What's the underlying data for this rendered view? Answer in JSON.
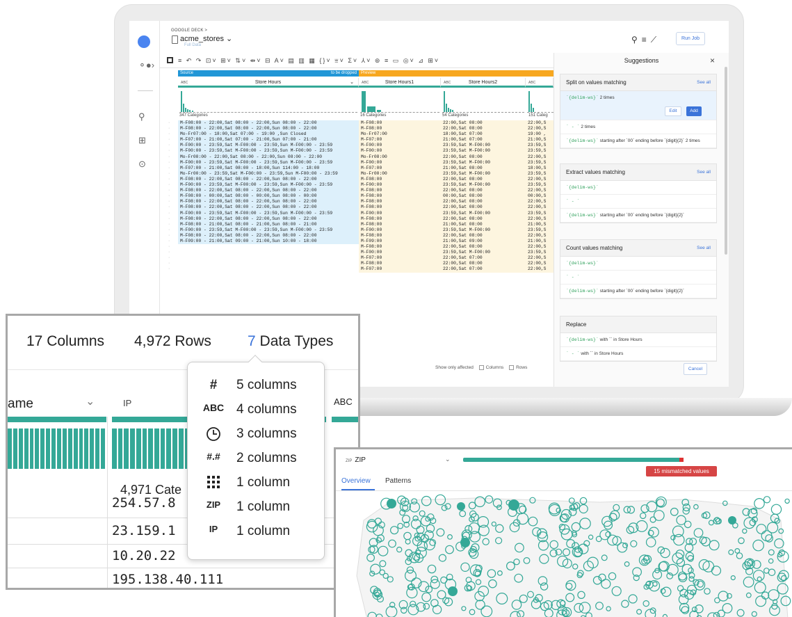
{
  "app": {
    "brand": "GOOGLE DECK >",
    "dataset": "acme_stores ⌄",
    "subtitle": "Full Data",
    "run_job": "Run Job"
  },
  "toolbar": {
    "icons": "≡  ↶ ↷  ⊡˅ ⊞˅ ⇅˅  ⇹˅ ⊟  A˅  ▤ ▥ ▦  {}˅  ⩸˅  Σ˅ ⅄˅  ⊚ ≡  ▭  ◎˅   ⊿ ⊞˅"
  },
  "grid": {
    "source_label": "Source",
    "dropped_label": "to be dropped",
    "preview_label": "Preview",
    "columns": [
      {
        "type": "ABC",
        "name": "Store Hours",
        "categories": "347 Categories"
      },
      {
        "type": "ABC",
        "name": "Store Hours1",
        "categories": "16 Categories"
      },
      {
        "type": "ABC",
        "name": "Store Hours2",
        "categories": "54 Categories"
      },
      {
        "type": "ABC",
        "name": "",
        "categories": "151 Categ"
      }
    ],
    "rows": [
      [
        "M-F08:00 - 22:00,Sat 08:00 - 22:00,Sun 08:00 - 22:00",
        "M-F08:00",
        "22:00,Sat 08:00",
        "22:00,S"
      ],
      [
        "M-F08:00 - 22:00,Sat 08:00 - 22:00,Sun 08:00 - 22:00",
        "M-F08:00",
        "22:00,Sat 08:00",
        "22:00,S"
      ],
      [
        "Mo-Fr07:00 - 18:00,Sat 07:00 - 19:00 ,Sun Closed",
        "Mo-Fr07:00",
        "18:00,Sat 07:00",
        "19:00 ,"
      ],
      [
        "M-F07:00 - 21:00,Sat 07:00 - 21:00,Sun 07:00 - 21:00",
        "M-F07:00",
        "21:00,Sat 07:00",
        "21:00,S"
      ],
      [
        "M-F00:00 - 23:59,Sat M-F00:00 - 23:59,Sun M-F00:00 - 23:59",
        "M-F00:00",
        "23:59,Sat M-F00:00",
        "23:59,S"
      ],
      [
        "M-F00:00 - 23:59,Sat M-F00:00 - 23:59,Sun M-F00:00 - 23:59",
        "M-F00:00",
        "23:59,Sat M-F00:00",
        "23:59,S"
      ],
      [
        "Mo-Fr08:00 - 22:00,Sat 08:00 - 22:00,Sun 08:00 - 22:00",
        "Mo-Fr08:00",
        "22:00,Sat 08:00",
        "22:00,S"
      ],
      [
        "M-F00:00 - 23:59,Sat M-F00:00 - 23:59,Sun M-F00:00 - 23:59",
        "M-F00:00",
        "23:59,Sat M-F00:00",
        "23:59,S"
      ],
      [
        "M-F07:00 - 21:00,Sat 08:00 - 18:00,Sun 114:00 - 18:00",
        "M-F07:00",
        "21:00,Sat 08:00",
        "18:00,S"
      ],
      [
        "Mo-Fr00:00 - 23:59,Sat M-F00:00 - 23:59,Sun M-F00:00 - 23:59",
        "Mo-Fr00:00",
        "23:59,Sat M-F00:00",
        "23:59,S"
      ],
      [
        "M-F08:00 - 22:00,Sat 08:00 - 22:00,Sun 08:00 - 22:00",
        "M-F08:00",
        "22:00,Sat 08:00",
        "22:00,S"
      ],
      [
        "M-F00:00 - 23:59,Sat M-F00:00 - 23:59,Sun M-F00:00 - 23:59",
        "M-F00:00",
        "23:59,Sat M-F00:00",
        "23:59,S"
      ],
      [
        "M-F08:00 - 22:00,Sat 08:00 - 22:00,Sun 08:00 - 22:00",
        "M-F08:00",
        "22:00,Sat 08:00",
        "22:00,S"
      ],
      [
        "M-F08:00 - 00:00,Sat 08:00 - 00:00,Sun 08:00 - 00:00",
        "M-F08:00",
        "00:00,Sat 08:00",
        "00:00,S"
      ],
      [
        "M-F08:00 - 22:00,Sat 08:00 - 22:00,Sun 08:00 - 22:00",
        "M-F08:00",
        "22:00,Sat 08:00",
        "22:00,S"
      ],
      [
        "M-F08:00 - 22:00,Sat 08:00 - 22:00,Sun 08:00 - 22:00",
        "M-F08:00",
        "22:00,Sat 08:00",
        "22:00,S"
      ],
      [
        "M-F00:00 - 23:59,Sat M-F00:00 - 23:59,Sun M-F00:00 - 23:59",
        "M-F00:00",
        "23:59,Sat M-F00:00",
        "23:59,S"
      ],
      [
        "M-F08:00 - 22:00,Sat 08:00 - 22:00,Sun 08:00 - 22:00",
        "M-F08:00",
        "22:00,Sat 08:00",
        "22:00,S"
      ],
      [
        "M-F08:00 - 21:00,Sat 08:00 - 21:00,Sun 08:00 - 21:00",
        "M-F08:00",
        "21:00,Sat 08:00",
        "21:00,S"
      ],
      [
        "M-F00:00 - 23:59,Sat M-F00:00 - 23:59,Sun M-F00:00 - 23:59",
        "M-F00:00",
        "23:59,Sat M-F00:00",
        "23:59,S"
      ],
      [
        "M-F08:00 - 22:00,Sat 08:00 - 22:00,Sun 08:00 - 22:00",
        "M-F08:00",
        "22:00,Sat 08:00",
        "22:00,S"
      ],
      [
        "M-F09:00 - 21:00,Sat 09:00 - 21:00,Sun 10:00 - 18:00",
        "M-F09:00",
        "21:00,Sat 09:00",
        "21:00,S"
      ],
      [
        "",
        "M-F08:00",
        "22:00,Sat 08:00",
        "22:00,S"
      ],
      [
        "",
        "M-F00:00",
        "23:59,Sat M-F00:00",
        "23:59,S"
      ],
      [
        "",
        "M-F07:00",
        "22:00,Sat 07:00",
        "22:00,S"
      ],
      [
        "",
        "M-F08:00",
        "22:00,Sat 08:00",
        "22:00,S"
      ],
      [
        "",
        "M-F07:00",
        "22:00,Sat 07:00",
        "22:00,S"
      ]
    ],
    "show_only": "Show only affected",
    "columns_label": "Columns",
    "rows_label": "Rows"
  },
  "suggestions": {
    "title": "Suggestions",
    "close": "×",
    "see_all": "See all",
    "cards": [
      {
        "title": "Split on values matching",
        "items": [
          {
            "code": "`{delim-ws}`",
            "text": " 2 times"
          },
          {
            "code": "` - `",
            "text": " 2 times"
          },
          {
            "code": "`{delim-ws}`",
            "text": " starting after `00` ending before `{digit}{2}` 2 times"
          }
        ]
      },
      {
        "title": "Extract values matching",
        "items": [
          {
            "code": "`{delim-ws}`",
            "text": ""
          },
          {
            "code": "` - `",
            "text": ""
          },
          {
            "code": "`{delim-ws}`",
            "text": " starting after `00` ending before `{digit}{2}`"
          }
        ]
      },
      {
        "title": "Count values matching",
        "items": [
          {
            "code": "`{delim-ws}`",
            "text": ""
          },
          {
            "code": "` - `",
            "text": ""
          },
          {
            "code": "`{delim-ws}`",
            "text": " starting after `00` ending before `{digit}{2}`"
          }
        ]
      },
      {
        "title": "Replace",
        "items": [
          {
            "code": "`{delim-ws}`",
            "text": " with `` in Store Hours"
          },
          {
            "code": "` - `",
            "text": " with `` in Store Hours"
          }
        ]
      }
    ],
    "edit": "Edit",
    "add": "Add",
    "cancel": "Cancel"
  },
  "summary": {
    "columns": "17 Columns",
    "rows": "4,972 Rows",
    "types_count": "7",
    "types_label": "Data Types",
    "col_left": "ame",
    "col_ip": "IP",
    "col_abc": "ABC",
    "categories": "4,971 Cate",
    "ips": [
      "254.57.8",
      "23.159.1",
      "10.20.22",
      "195.138.40.111"
    ],
    "types": [
      {
        "icon": "#",
        "label": "5 columns"
      },
      {
        "icon": "ABC",
        "label": "4 columns"
      },
      {
        "icon": "clock",
        "label": "3 columns"
      },
      {
        "icon": "#.#",
        "label": "2 columns"
      },
      {
        "icon": "grid",
        "label": "1 column"
      },
      {
        "icon": "ZIP",
        "label": "1 column"
      },
      {
        "icon": "IP",
        "label": "1 column"
      }
    ]
  },
  "zip_panel": {
    "type": "ZIP",
    "column": "ZIP",
    "mismatched": "15 mismatched values",
    "tabs": [
      "Overview",
      "Patterns"
    ],
    "colors": {
      "accent": "#34a897",
      "error": "#d64545"
    }
  }
}
